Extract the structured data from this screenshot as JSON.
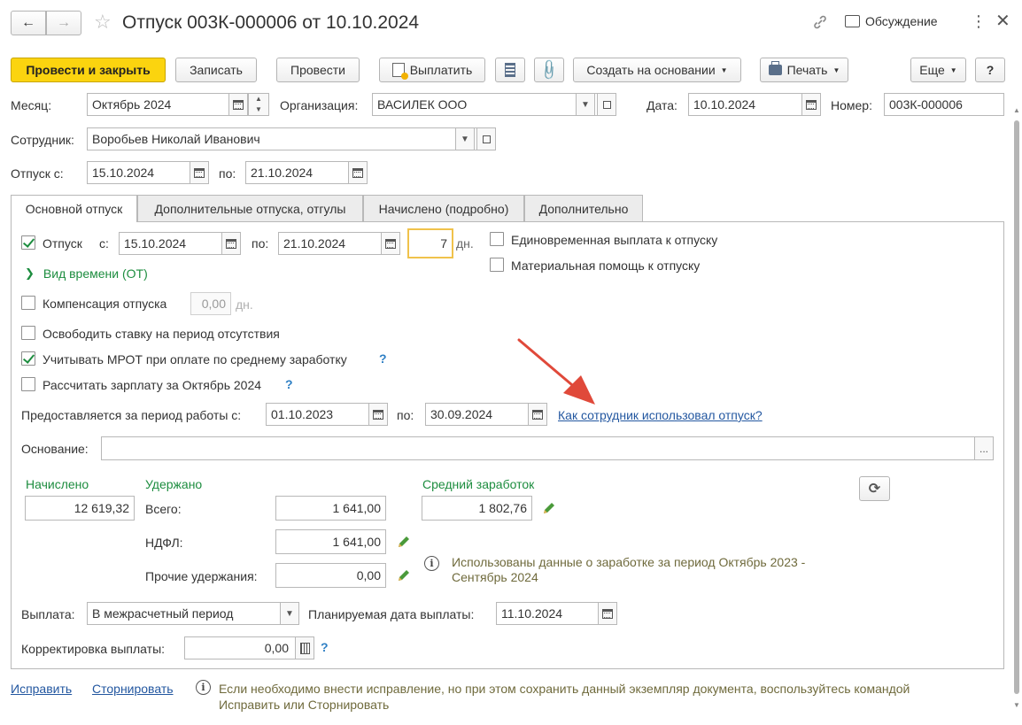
{
  "window": {
    "title": "Отпуск 003К-000006 от 10.10.2024",
    "discussion_label": "Обсуждение"
  },
  "toolbar": {
    "post_close": "Провести и закрыть",
    "save": "Записать",
    "post": "Провести",
    "pay": "Выплатить",
    "create_based": "Создать на основании",
    "print": "Печать",
    "more": "Еще",
    "help": "?"
  },
  "header": {
    "month_label": "Месяц:",
    "month_value": "Октябрь 2024",
    "org_label": "Организация:",
    "org_value": "ВАСИЛЕК ООО",
    "date_label": "Дата:",
    "date_value": "10.10.2024",
    "number_label": "Номер:",
    "number_value": "003К-000006",
    "employee_label": "Сотрудник:",
    "employee_value": "Воробьев Николай Иванович",
    "vac_from_label": "Отпуск с:",
    "vac_from_value": "15.10.2024",
    "vac_to_label": "по:",
    "vac_to_value": "21.10.2024"
  },
  "tabs": [
    {
      "label": "Основной отпуск",
      "active": true
    },
    {
      "label": "Дополнительные отпуска, отгулы",
      "active": false
    },
    {
      "label": "Начислено (подробно)",
      "active": false
    },
    {
      "label": "Дополнительно",
      "active": false
    }
  ],
  "main": {
    "vacation_checkbox": "Отпуск",
    "from_label": "с:",
    "from_value": "15.10.2024",
    "to_label": "по:",
    "to_value": "21.10.2024",
    "days_value": "7",
    "days_unit": "дн.",
    "lump_sum": "Единовременная выплата к отпуску",
    "material_aid": "Материальная помощь к отпуску",
    "time_type": "Вид времени (ОТ)",
    "compensation": "Компенсация отпуска",
    "compensation_days": "0,00",
    "compensation_unit": "дн.",
    "free_rate": "Освободить ставку на период отсутствия",
    "mrot": "Учитывать МРОТ при оплате по среднему заработку",
    "calc_salary": "Рассчитать зарплату за Октябрь 2024",
    "period_label": "Предоставляется за период работы с:",
    "period_from": "01.10.2023",
    "period_to_label": "по:",
    "period_to": "30.09.2024",
    "usage_link": "Как сотрудник использовал отпуск?",
    "basis_label": "Основание:",
    "basis_value": "",
    "accrued_label": "Начислено",
    "accrued_value": "12 619,32",
    "withheld_label": "Удержано",
    "total_label": "Всего:",
    "total_value": "1 641,00",
    "ndfl_label": "НДФЛ:",
    "ndfl_value": "1 641,00",
    "other_label": "Прочие удержания:",
    "other_value": "0,00",
    "avg_label": "Средний заработок",
    "avg_value": "1 802,76",
    "info_text_1": "Использованы данные о заработке за период Октябрь 2023 -",
    "info_text_2": "Сентябрь 2024",
    "payout_label": "Выплата:",
    "payout_value": "В межрасчетный период",
    "planned_label": "Планируемая дата выплаты:",
    "planned_value": "11.10.2024",
    "correction_label": "Корректировка выплаты:",
    "correction_value": "0,00"
  },
  "footer": {
    "fix_link": "Исправить",
    "storno_link": "Сторнировать",
    "note_1": "Если необходимо внести исправление, но при этом сохранить данный экземпляр документа, воспользуйтесь командой",
    "note_2": "Исправить или Сторнировать"
  },
  "colors": {
    "primary_button": "#fbd40f",
    "green_text": "#1d8d3f",
    "link": "#2357a0",
    "annotation_arrow": "#e0493a",
    "days_highlight": "#f0c24b"
  }
}
